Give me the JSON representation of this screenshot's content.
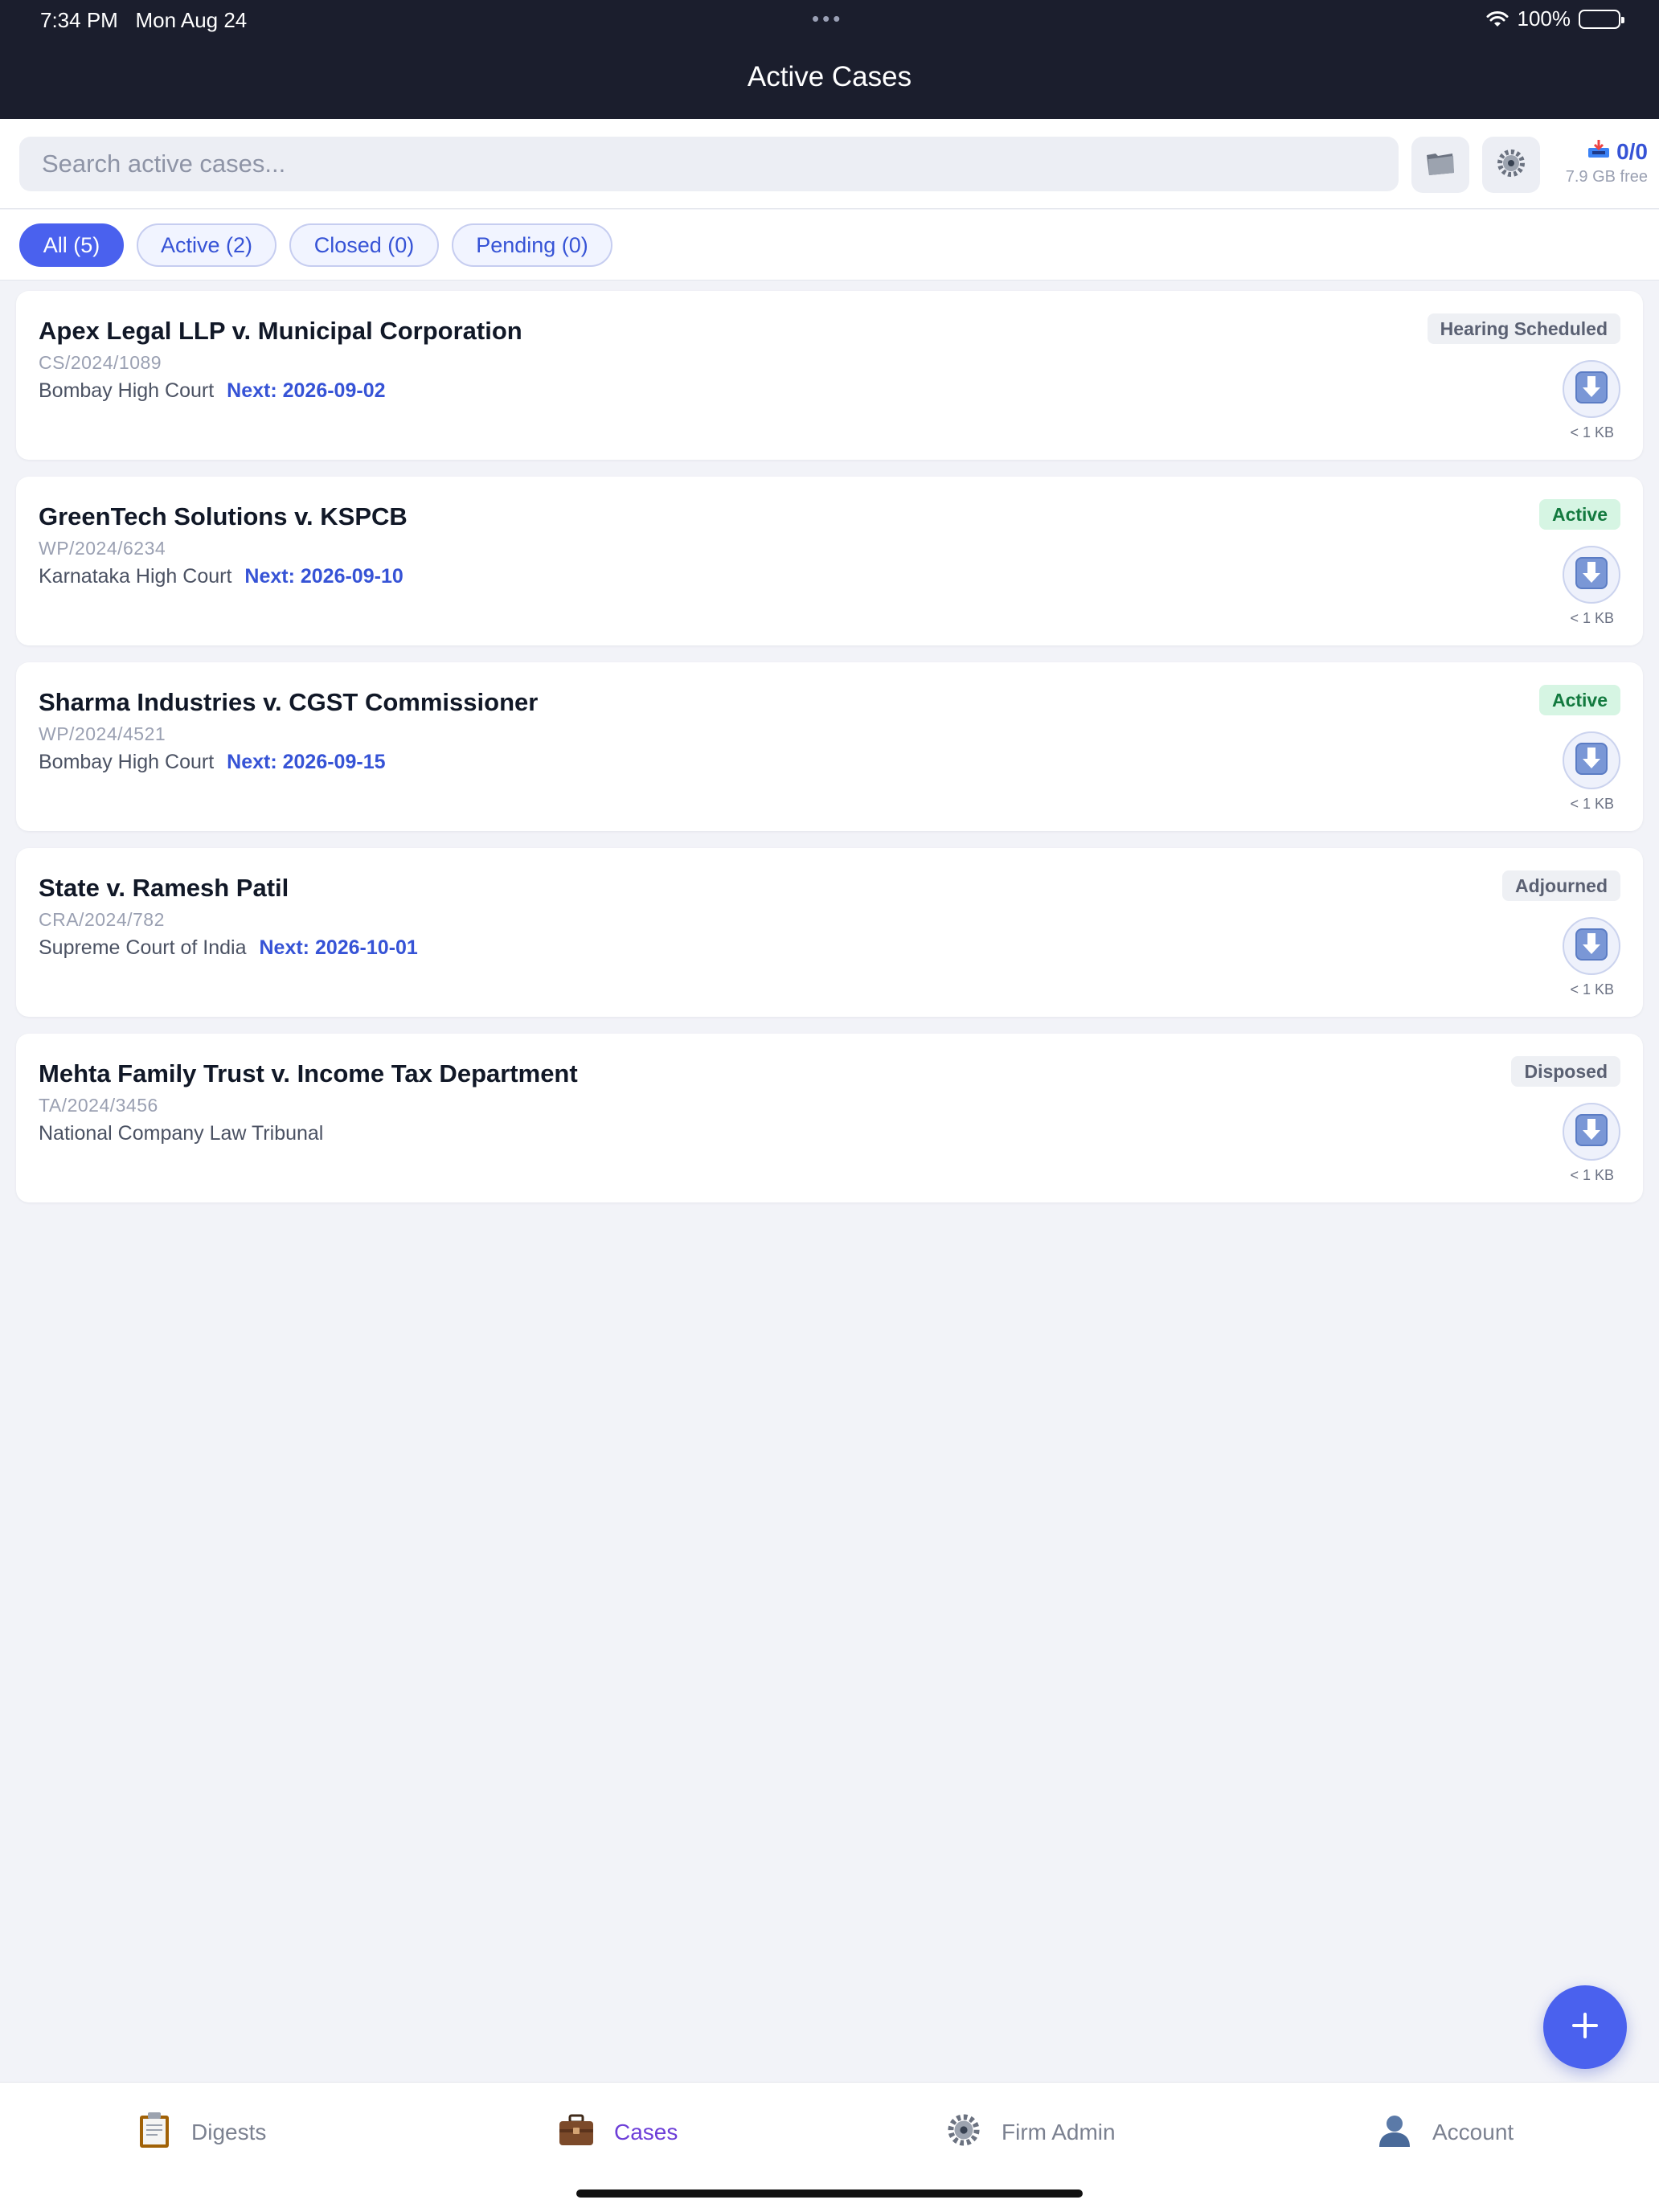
{
  "status_bar": {
    "time": "7:34 PM   Mon Aug 24",
    "dots": "•••",
    "battery": "100%"
  },
  "header": {
    "title": "Active Cases"
  },
  "search": {
    "placeholder": "Search active cases..."
  },
  "storage": {
    "count": "0/0",
    "free": "7.9 GB free"
  },
  "filters": [
    {
      "label": "All (5)",
      "selected": true
    },
    {
      "label": "Active (2)",
      "selected": false
    },
    {
      "label": "Closed (0)",
      "selected": false
    },
    {
      "label": "Pending (0)",
      "selected": false
    }
  ],
  "cases": [
    {
      "title": "Apex Legal LLP v. Municipal Corporation",
      "number": "CS/2024/1089",
      "court": "Bombay High Court",
      "next": "Next: 2026-09-02",
      "status": "Hearing Scheduled",
      "size": "< 1 KB"
    },
    {
      "title": "GreenTech Solutions v. KSPCB",
      "number": "WP/2024/6234",
      "court": "Karnataka High Court",
      "next": "Next: 2026-09-10",
      "status": "Active",
      "size": "< 1 KB"
    },
    {
      "title": "Sharma Industries v. CGST Commissioner",
      "number": "WP/2024/4521",
      "court": "Bombay High Court",
      "next": "Next: 2026-09-15",
      "status": "Active",
      "size": "< 1 KB"
    },
    {
      "title": "State v. Ramesh Patil",
      "number": "CRA/2024/782",
      "court": "Supreme Court of India",
      "next": "Next: 2026-10-01",
      "status": "Adjourned",
      "size": "< 1 KB"
    },
    {
      "title": "Mehta Family Trust v. Income Tax Department",
      "number": "TA/2024/3456",
      "court": "National Company Law Tribunal",
      "next": "",
      "status": "Disposed",
      "size": "< 1 KB"
    }
  ],
  "tabs": [
    {
      "label": "Digests",
      "icon": "clipboard-icon"
    },
    {
      "label": "Cases",
      "icon": "briefcase-icon",
      "active": true
    },
    {
      "label": "Firm Admin",
      "icon": "gear-icon"
    },
    {
      "label": "Account",
      "icon": "user-icon"
    }
  ],
  "colors": {
    "header_bg": "#1b1e2d",
    "accent": "#4a61ee",
    "link": "#3653d6",
    "active_badge_bg": "#d6f5e3",
    "active_badge_text": "#137a3f",
    "tab_active": "#6d3fd8"
  }
}
